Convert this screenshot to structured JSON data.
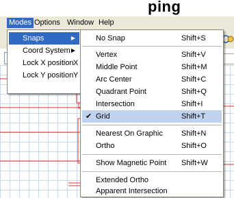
{
  "window_title_fragment": "ping",
  "menubar": {
    "items": [
      "Modes",
      "Options",
      "Window",
      "Help"
    ]
  },
  "modes_menu": {
    "items": [
      {
        "label": "Snaps",
        "submenu": true
      },
      {
        "label": "Coord System",
        "submenu": true
      },
      {
        "label": "Lock X position",
        "shortcut": "X"
      },
      {
        "label": "Lock Y position",
        "shortcut": "Y"
      }
    ]
  },
  "snaps_menu": {
    "items": [
      {
        "label": "No Snap",
        "shortcut": "Shift+S"
      },
      {
        "label": "Vertex",
        "shortcut": "Shift+V"
      },
      {
        "label": "Middle Point",
        "shortcut": "Shift+M"
      },
      {
        "label": "Arc Center",
        "shortcut": "Shift+C"
      },
      {
        "label": "Quadrant Point",
        "shortcut": "Shift+Q"
      },
      {
        "label": "Intersection",
        "shortcut": "Shift+I"
      },
      {
        "label": "Grid",
        "shortcut": "Shift+T",
        "checked": true
      },
      {
        "label": "Nearest On Graphic",
        "shortcut": "Shift+N"
      },
      {
        "label": "Ortho",
        "shortcut": "Shift+O"
      },
      {
        "label": "Show Magnetic Point",
        "shortcut": "Shift+W"
      },
      {
        "label": "Extended Ortho"
      },
      {
        "label": "Apparent Intersection"
      }
    ],
    "check_glyph": "✔"
  },
  "colors": {
    "menu_highlight": "#316ac5",
    "selected_item": "#c1d2ee",
    "drawing_lines": "#e03030",
    "grid_lines": "#c9d7ef"
  },
  "icons": {
    "submenu_arrow": "▶",
    "checkmark": "✔"
  }
}
